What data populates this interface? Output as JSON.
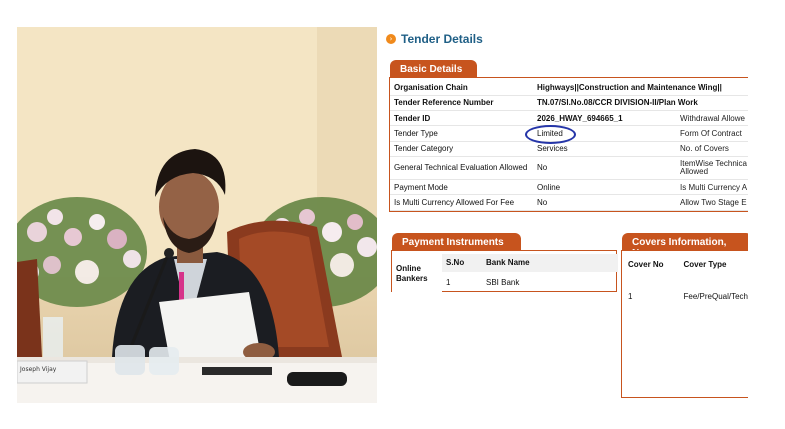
{
  "photo": {
    "nameplate_text": "Joseph Vijay"
  },
  "tender": {
    "title": "Tender Details",
    "basic_details": {
      "tab_label": "Basic Details",
      "rows": [
        {
          "label": "Organisation Chain",
          "value": "Highways||Construction and Maintenance Wing||",
          "extra": "",
          "bold": true
        },
        {
          "label": "Tender Reference Number",
          "value": "TN.07/Sl.No.08/CCR DIVISION-II/Plan Work",
          "extra": "",
          "bold": true
        },
        {
          "label": "Tender ID",
          "value": "2026_HWAY_694665_1",
          "extra": "Withdrawal Allowe",
          "bold": true
        },
        {
          "label": "Tender Type",
          "value": "Limited",
          "extra": "Form Of Contract",
          "bold": false
        },
        {
          "label": "Tender Category",
          "value": "Services",
          "extra": "No. of Covers",
          "bold": false
        },
        {
          "label": "General Technical Evaluation Allowed",
          "value": "No",
          "extra": "ItemWise Technica Allowed",
          "bold": false
        },
        {
          "label": "Payment Mode",
          "value": "Online",
          "extra": "Is Multi Currency A",
          "bold": false
        },
        {
          "label": "Is Multi Currency Allowed For Fee",
          "value": "No",
          "extra": "Allow Two Stage E",
          "bold": false
        }
      ]
    },
    "payment_instruments": {
      "tab_label": "Payment Instruments",
      "online_bankers_label": "Online Bankers",
      "headers": [
        "S.No",
        "Bank Name"
      ],
      "rows": [
        [
          "1",
          "SBI Bank"
        ]
      ]
    },
    "covers": {
      "tab_label": "Covers Information, No.",
      "headers": [
        "Cover No",
        "Cover Type"
      ],
      "rows": [
        [
          "1",
          "Fee/PreQual/Tech"
        ]
      ]
    }
  },
  "colors": {
    "tab_orange": "#c7541e",
    "title_blue": "#1f5f86",
    "highlight_oval": "#2535a8"
  }
}
